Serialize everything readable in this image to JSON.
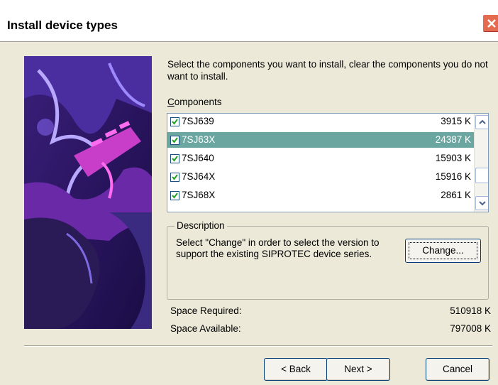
{
  "window": {
    "title": "Install device types"
  },
  "instructions": "Select the components you want to install, clear the components you do not want to install.",
  "components": {
    "label_prefix": "C",
    "label_rest": "omponents",
    "items": [
      {
        "name": "7SJ639",
        "size": "3915 K",
        "checked": true,
        "selected": false
      },
      {
        "name": "7SJ63X",
        "size": "24387 K",
        "checked": true,
        "selected": true
      },
      {
        "name": "7SJ640",
        "size": "15903 K",
        "checked": true,
        "selected": false
      },
      {
        "name": "7SJ64X",
        "size": "15916 K",
        "checked": true,
        "selected": false
      },
      {
        "name": "7SJ68X",
        "size": "2861 K",
        "checked": true,
        "selected": false
      }
    ]
  },
  "description": {
    "legend": "Description",
    "text": "Select \"Change\" in order to select the version to support the existing SIPROTEC device series.",
    "change_label": "Change..."
  },
  "space": {
    "required_label": "Space Required:",
    "required_value": "510918 K",
    "available_label": "Space Available:",
    "available_value": "797008 K"
  },
  "buttons": {
    "back_label": "< Back",
    "next_label": "Next >",
    "cancel_label": "Cancel"
  },
  "colors": {
    "selection": "#6ba6a0",
    "close": "#e46b4f"
  }
}
